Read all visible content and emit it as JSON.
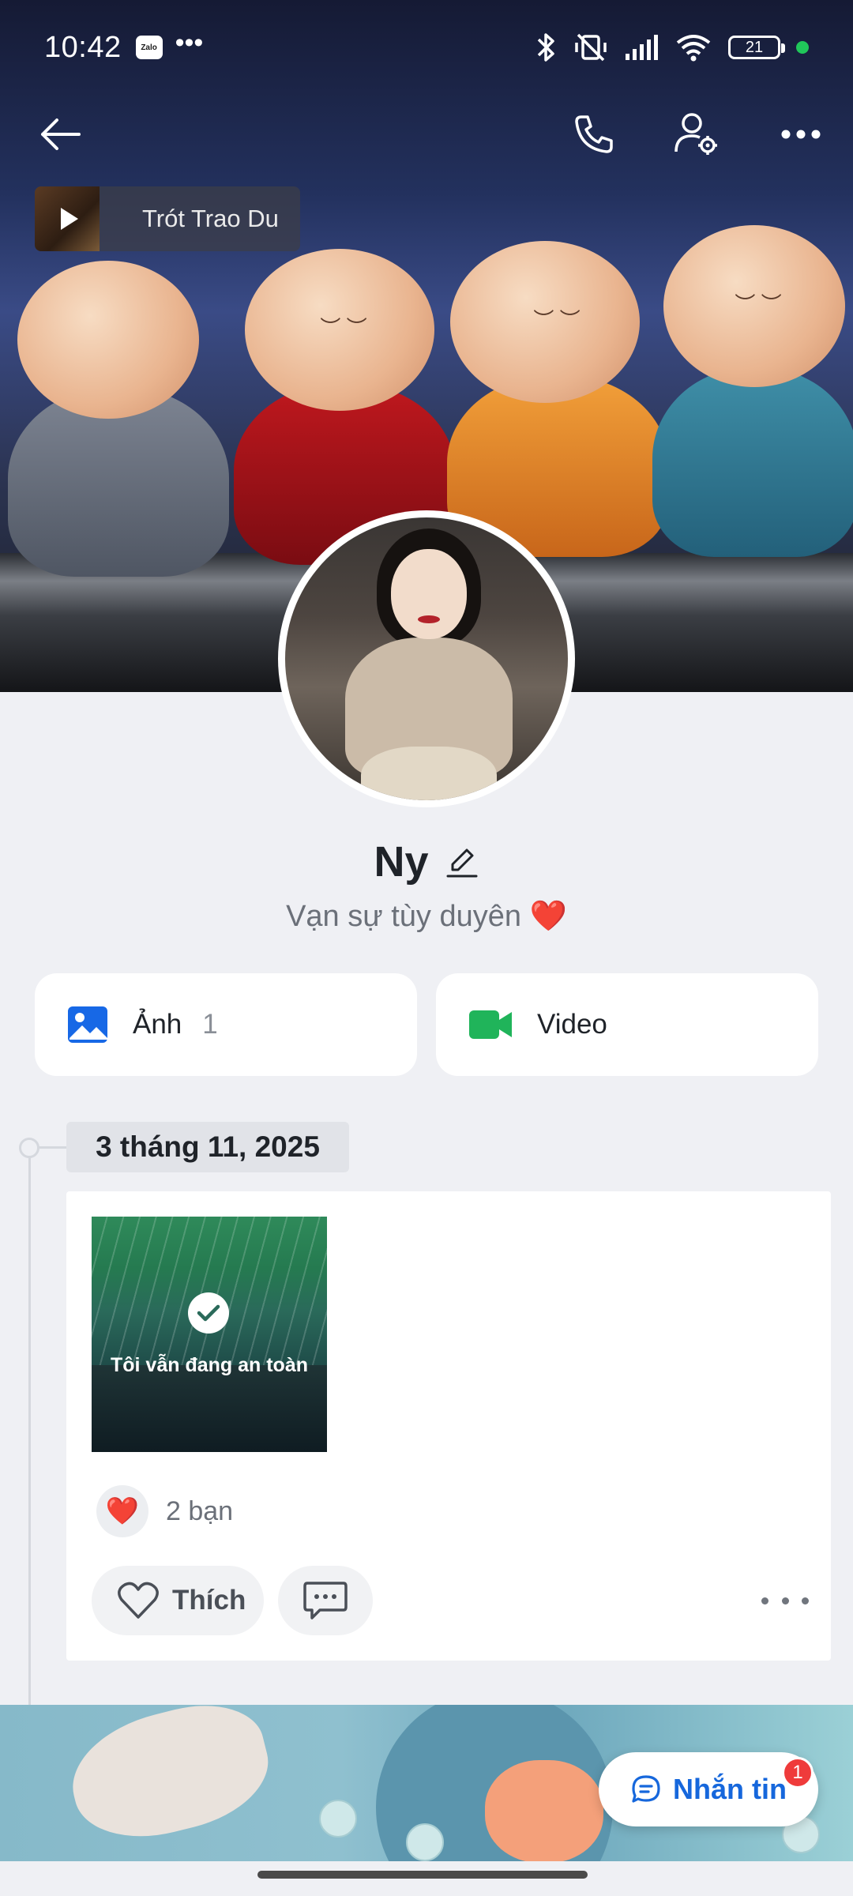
{
  "status_bar": {
    "time": "10:42",
    "app_badge": "Zalo",
    "overflow": "•••",
    "battery": "21"
  },
  "toolbar": {
    "back_icon": "arrow-left-icon",
    "call_icon": "phone-icon",
    "settings_icon": "user-settings-icon",
    "more_icon": "more-horizontal-icon"
  },
  "music": {
    "title": "Trót Trao Du"
  },
  "profile": {
    "name": "Ny",
    "bio": "Vạn sự tùy duyên ❤️"
  },
  "media": {
    "photos_label": "Ảnh",
    "photos_count": "1",
    "video_label": "Video"
  },
  "timeline": {
    "date": "3 tháng 11, 2025"
  },
  "post": {
    "image_caption": "Tôi vẫn đang an toàn",
    "reaction_icon": "❤️",
    "reaction_text": "2 bạn",
    "like_label": "Thích"
  },
  "message_button": {
    "label": "Nhắn tin",
    "badge": "1"
  },
  "colors": {
    "accent_blue": "#1667dc",
    "video_green": "#20b45a",
    "badge_red": "#ef3b3b",
    "page_bg": "#eff0f4"
  }
}
